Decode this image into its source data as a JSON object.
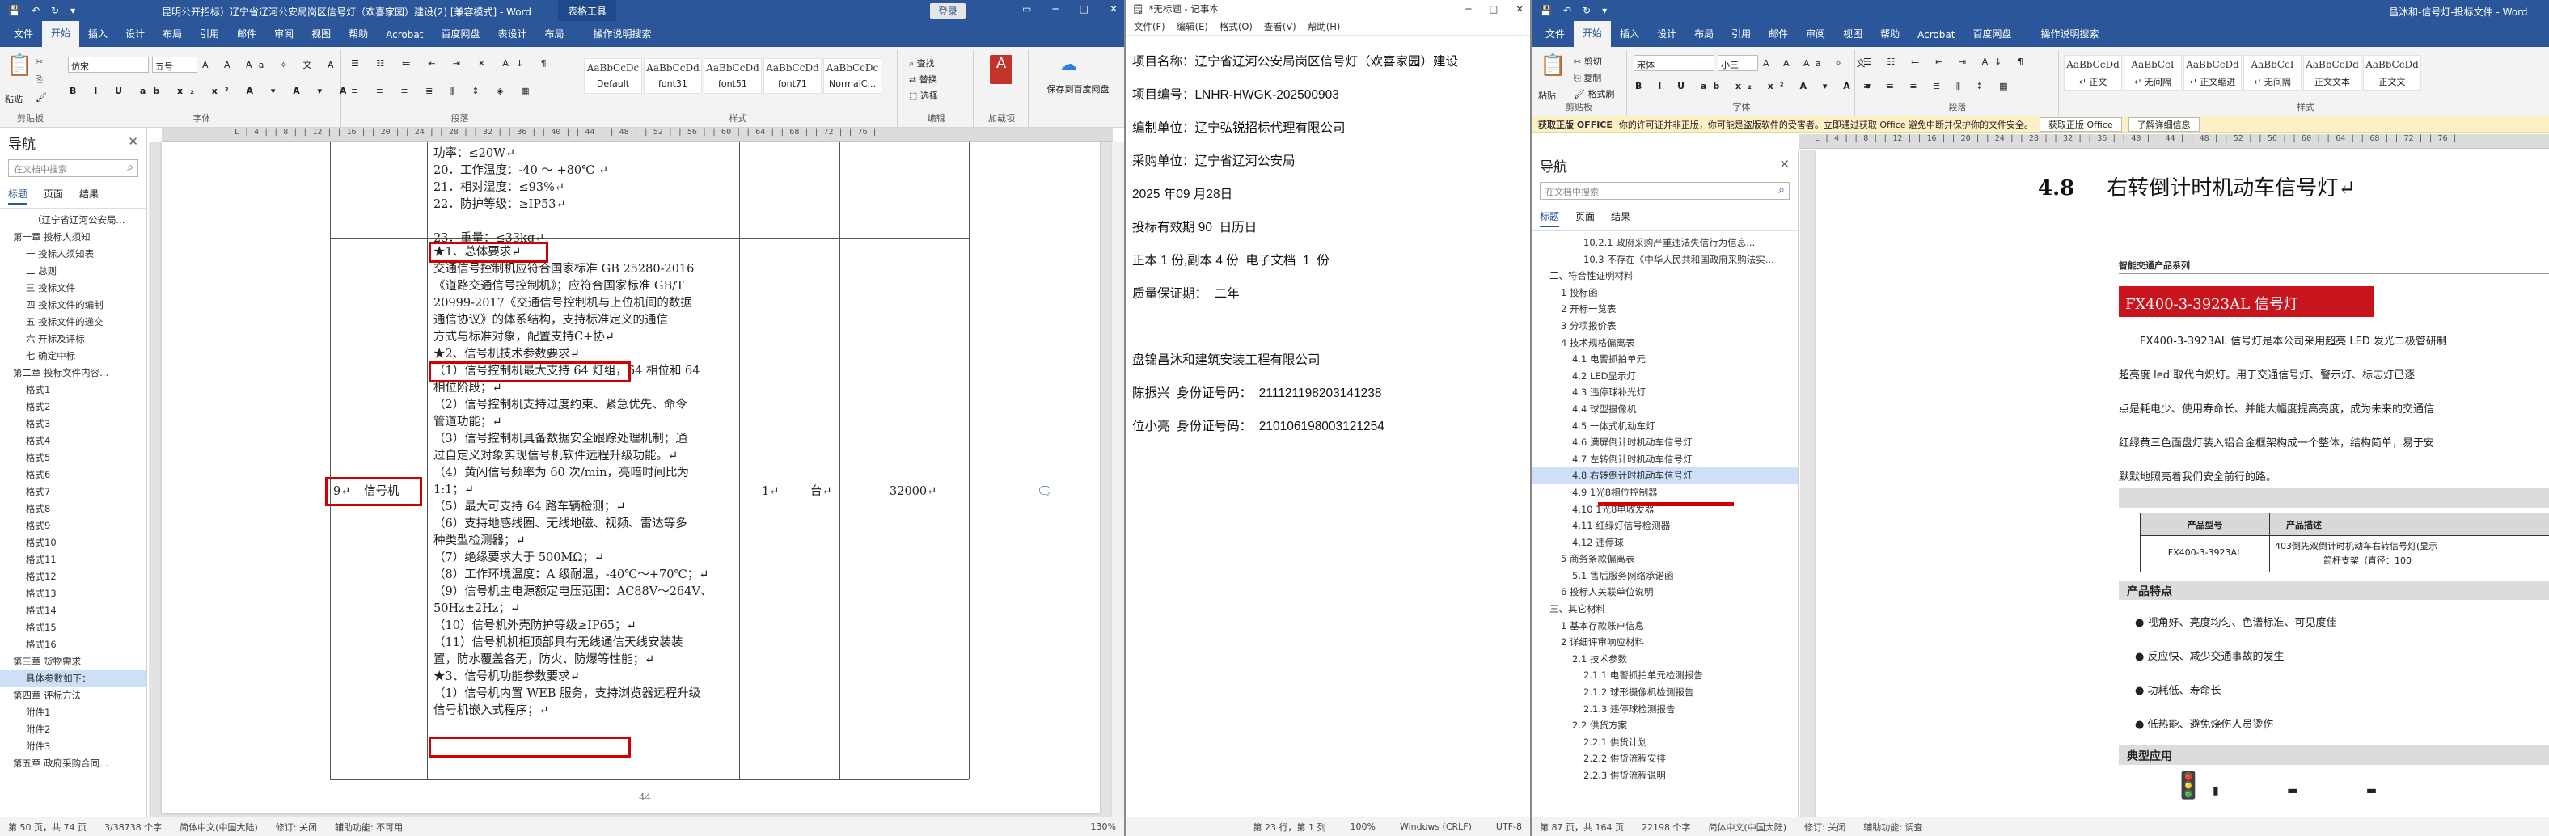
{
  "left_word": {
    "title": "昆明公开招标）辽宁省辽河公安局岗区信号灯（欢喜家园）建设(2) [兼容模式] - Word",
    "context_tab": "表格工具",
    "login": "登录",
    "tabs": [
      "文件",
      "开始",
      "插入",
      "设计",
      "布局",
      "引用",
      "邮件",
      "审阅",
      "视图",
      "帮助",
      "Acrobat",
      "百度网盘",
      "表设计",
      "布局"
    ],
    "search_hint": "操作说明搜索",
    "ribbon": {
      "clipboard": "剪贴板",
      "paste": "粘贴",
      "font_group": "字体",
      "font_name": "仿宋",
      "font_size": "五号",
      "paragraph": "段落",
      "styles_group": "样式",
      "editing": "编辑",
      "acrobat": "加载项",
      "baidu": "保存到百度网盘",
      "save_label": "保存",
      "find": "查找",
      "replace": "替换",
      "select": "选择",
      "styles": [
        {
          "sample": "AaBbCcDc",
          "name": "Default"
        },
        {
          "sample": "AaBbCcDd",
          "name": "font31"
        },
        {
          "sample": "AaBbCcDd",
          "name": "font51"
        },
        {
          "sample": "AaBbCcDd",
          "name": "font71"
        },
        {
          "sample": "AaBbCcDc",
          "name": "NormalC..."
        }
      ]
    },
    "ruler": "L  |  4  |  |  8  |  |  12  |  |  16  |  |  20  |  |  24  |  |  28  |  |  32  |  |  36  |  |  40  |  |  44  |  |  48  |  |  52  |  |  56  |  |  60  |  |  64  |  |  68  |  |  72  |  |  76  |",
    "nav": {
      "title": "导航",
      "search_placeholder": "在文档中搜索",
      "tabs": [
        "标题",
        "页面",
        "结果"
      ],
      "items": [
        "（辽宁省辽河公安局...",
        "第一章 投标人须知",
        "一 投标人须知表",
        "二 总则",
        "三 投标文件",
        "四 投标文件的编制",
        "五 投标文件的递交",
        "六 开标及评标",
        "七 确定中标",
        "第二章 投标文件内容...",
        "格式1",
        "格式2",
        "格式3",
        "格式4",
        "格式5",
        "格式6",
        "格式7",
        "格式8",
        "格式9",
        "格式10",
        "格式11",
        "格式12",
        "格式13",
        "格式14",
        "格式15",
        "格式16",
        "第三章 货物需求",
        "具体参数如下：",
        "第四章 评标方法",
        "附件1",
        "附件2",
        "附件3",
        "第五章 政府采购合同..."
      ],
      "selected_index": 27
    },
    "doc": {
      "top_lines": [
        "功率：≤20W↵",
        "20．工作温度：-40 ～ +80℃ ↵",
        "21．相对湿度：≤93%↵",
        "22．防护等级：≥IP53↵",
        "",
        "23．重量：≤33kg↵"
      ],
      "row_no": "9↵",
      "row_name": "信号机",
      "head1": "★1、总体要求↵",
      "para1": [
        "交通信号控制机应符合国家标准 GB 25280-2016",
        "《道路交通信号控制机》；应符合国家标准 GB/T",
        "20999-2017《交通信号控制机与上位机间的数据",
        "通信协议》的体系结构，支持标准定义的通信",
        "方式与标准对象，配置支持C+协↵"
      ],
      "head2": "★2、信号机技术参数要求↵",
      "para2": [
        "（1）信号控制机最大支持 64 灯组，64 相位和 64",
        "相位阶段；↵",
        "（2）信号控制机支持过度约束、紧急优先、命令",
        "管道功能；↵",
        "（3）信号控制机具备数据安全跟踪处理机制；通",
        "过自定义对象实现信号机软件远程升级功能。↵",
        "（4）黄闪信号频率为 60 次/min，亮暗时间比为",
        "1:1；↵",
        "（5）最大可支持 64 路车辆检测；↵",
        "（6）支持地感线圈、无线地磁、视频、雷达等多",
        "种类型检测器；↵",
        "（7）绝缘要求大于 500MΩ；↵",
        "（8）工作环境温度：A 级耐温，-40℃～+70℃；↵",
        "（9）信号机主电源额定电压范围：AC88V～264V、",
        "50Hz±2Hz；↵",
        "（10）信号机外壳防护等级≥IP65；↵",
        "（11）信号机机柜顶部具有无线通信天线安装装",
        "置，防水覆盖各无，防火、防爆等性能；↵"
      ],
      "head3": "★3、信号机功能参数要求↵",
      "para3": [
        "（1）信号机内置 WEB 服务，支持浏览器远程升级",
        "信号机嵌入式程序；↵"
      ],
      "qty": "1↵",
      "unit": "台↵",
      "price": "32000↵",
      "page_no": "44"
    },
    "status": [
      "第 50 页，共 74 页",
      "3/38738 个字",
      "简体中文(中国大陆)",
      "修订: 关闭",
      "辅助功能: 不可用",
      "130%"
    ]
  },
  "notepad": {
    "title": "*无标题 - 记事本",
    "menu": [
      "文件(F)",
      "编辑(E)",
      "格式(O)",
      "查看(V)",
      "帮助(H)"
    ],
    "lines": [
      "项目名称：辽宁省辽河公安局岗区信号灯（欢喜家园）建设",
      "项目编号：LNHR-HWGK-202500903",
      "编制单位：辽宁弘锐招标代理有限公司",
      "采购单位：辽宁省辽河公安局",
      "2025 年09 月28日",
      "投标有效期 90  日历日",
      "正本 1 份,副本 4 份  电子文档  1  份",
      "质量保证期：  二年",
      "",
      "盘锦昌沐和建筑安装工程有限公司",
      "陈振兴  身份证号码：  211121198203141238",
      "位小亮  身份证号码：  210106198003121254"
    ],
    "status": [
      "第 23 行，第 1 列",
      "100%",
      "Windows (CRLF)",
      "UTF-8"
    ]
  },
  "right_word": {
    "title": "昌沐和-信号灯-投标文件 - Word",
    "tabs": [
      "文件",
      "开始",
      "插入",
      "设计",
      "布局",
      "引用",
      "邮件",
      "审阅",
      "视图",
      "帮助",
      "Acrobat",
      "百度网盘"
    ],
    "search_hint": "操作说明搜索",
    "ribbon": {
      "clipboard": "剪贴板",
      "paste": "粘贴",
      "cut": "剪切",
      "copy": "复制",
      "painter": "格式刷",
      "font_group": "字体",
      "font_name": "宋体",
      "font_size": "小三",
      "paragraph": "段落",
      "styles_group": "样式",
      "styles": [
        {
          "sample": "AaBbCcDd",
          "name": "↵ 正文"
        },
        {
          "sample": "AaBbCcI",
          "name": "↵ 无间隔"
        },
        {
          "sample": "AaBbCcDd",
          "name": "↵ 正文缩进"
        },
        {
          "sample": "AaBbCcI",
          "name": "↵ 无间隔"
        },
        {
          "sample": "AaBbCcDd",
          "name": "正文文本"
        },
        {
          "sample": "AaBbCcDd",
          "name": "正文文"
        }
      ]
    },
    "info": {
      "label": "获取正版 OFFICE",
      "text": "你的许可证并非正版，你可能是盗版软件的受害者。立即通过获取 Office 避免中断并保护你的文件安全。",
      "btn1": "获取正版 Office",
      "btn2": "了解详细信息"
    },
    "nav": {
      "title": "导航",
      "search_placeholder": "在文档中搜索",
      "tabs": [
        "标题",
        "页面",
        "结果"
      ],
      "items": [
        "10.2.1 政府采购严重违法失信行为信息...",
        "10.3 不存在《中华人民共和国政府采购法实...",
        "二、符合性证明材料",
        "1 投标函",
        "2 开标一览表",
        "3 分项报价表",
        "4 技术规格偏离表",
        "4.1 电警抓拍单元",
        "4.2 LED显示灯",
        "4.3 违停球补光灯",
        "4.4 球型摄像机",
        "4.5 一体式机动车灯",
        "4.6 满屏倒计时机动车信号灯",
        "4.7 左转倒计时机动车信号灯",
        "4.8 右转倒计时机动车信号灯",
        "4.9 1光8相位控制器",
        "4.10 1光8电收发器",
        "4.11 红绿灯信号检测器",
        "4.12 违停球",
        "5 商务条款偏离表",
        "5.1 售后服务网络承诺函",
        "6 投标人关联单位说明",
        "三、其它材料",
        "1 基本存款账户信息",
        "2 详细评审响应材料",
        "2.1 技术参数",
        "2.1.1 电警抓拍单元检测报告",
        "2.1.2 球形摄像机检测报告",
        "2.1.3 违停球检测报告",
        "2.2 供货方案",
        "2.2.1 供货计划",
        "2.2.2 供货流程安排",
        "2.2.3 供货流程说明"
      ],
      "indents": [
        4,
        4,
        1,
        2,
        2,
        2,
        2,
        3,
        3,
        3,
        3,
        3,
        3,
        3,
        3,
        3,
        3,
        3,
        3,
        2,
        3,
        2,
        1,
        2,
        2,
        3,
        4,
        4,
        4,
        3,
        4,
        4,
        4
      ],
      "selected_index": 14
    },
    "doc": {
      "heading_no": "4.8",
      "heading": "右转倒计时机动车信号灯↵",
      "brand": "智能交通产品系列",
      "product_title": "FX400-3-3923AL 信号灯",
      "intro": [
        "FX400-3-3923AL 信号灯是本公司采用超亮 LED 发光二极管研制",
        "超亮度 led 取代白炽灯。用于交通信号灯、警示灯、标志灯已逐",
        "点是耗电少、使用寿命长、并能大幅度提高亮度，成为未来的交通信",
        "红绿黄三色面盘灯装入铝合金框架构成一个整体，结构简单，易于安",
        "默默地照亮着我们安全前行的路。"
      ],
      "table_head": [
        "产品型号",
        "产品描述"
      ],
      "table_row": [
        "FX400-3-3923AL",
        "403倒先双倒计时机动车右转信号灯(显示",
        "箭杆支架（直径：100"
      ],
      "feature_title": "产品特点",
      "features": [
        "视角好、亮度均匀、色谱标准、可见度佳",
        "反应快、减少交通事故的发生",
        "功耗低、寿命长",
        "低热能、避免烧伤人员烫伤"
      ],
      "app_title": "典型应用"
    },
    "status": [
      "第 87 页，共 164 页",
      "22198 个字",
      "简体中文(中国大陆)",
      "修订: 关闭",
      "辅助功能: 调查"
    ]
  }
}
